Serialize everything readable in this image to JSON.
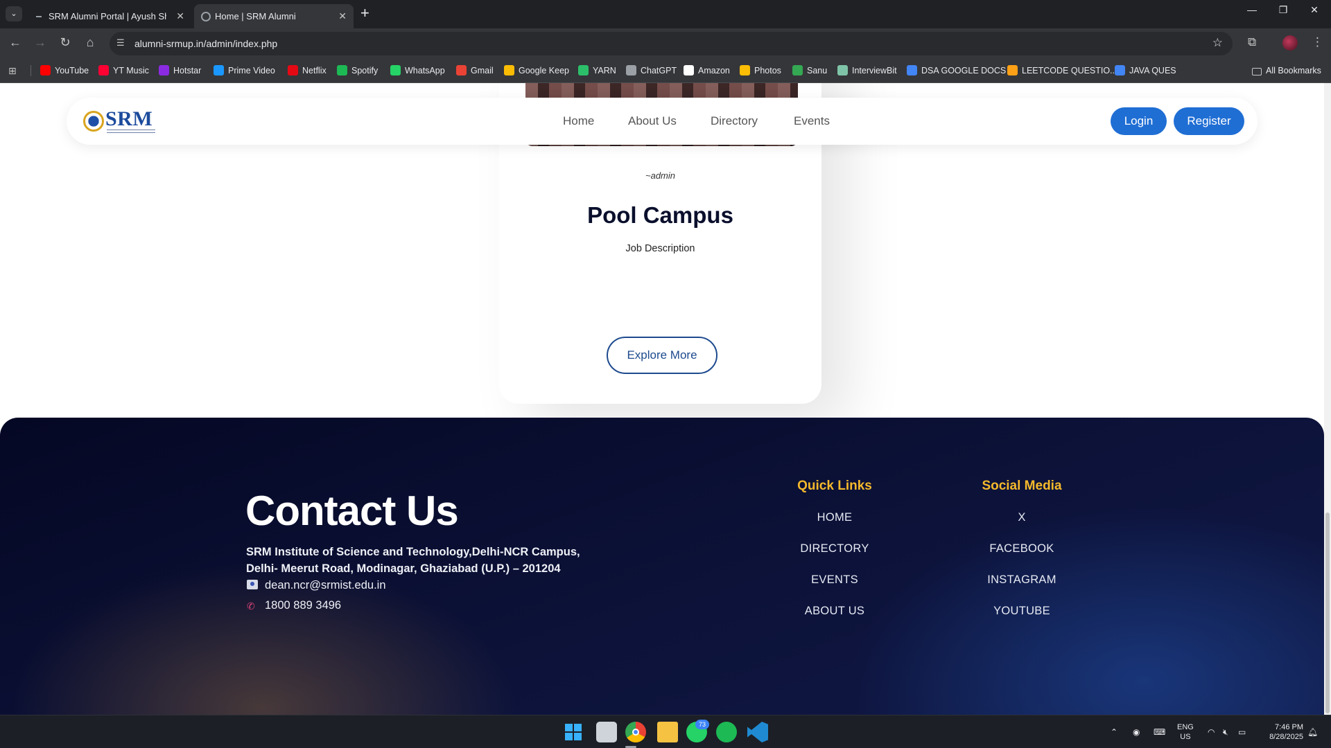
{
  "browser": {
    "tabs": [
      {
        "title": "SRM Alumni Portal | Ayush Sha",
        "active": false
      },
      {
        "title": "Home | SRM Alumni",
        "active": true
      }
    ],
    "url": "alumni-srmup.in/admin/index.php",
    "bookmarks": [
      {
        "label": "YouTube",
        "color": "#ff0000"
      },
      {
        "label": "YT Music",
        "color": "#ff0033"
      },
      {
        "label": "Hotstar",
        "color": "#8a2be2"
      },
      {
        "label": "Prime Video",
        "color": "#1a98ff"
      },
      {
        "label": "Netflix",
        "color": "#e50914"
      },
      {
        "label": "Spotify",
        "color": "#1db954"
      },
      {
        "label": "WhatsApp",
        "color": "#25d366"
      },
      {
        "label": "Gmail",
        "color": "#ea4335"
      },
      {
        "label": "Google Keep",
        "color": "#fbbc04"
      },
      {
        "label": "YARN",
        "color": "#2cbf6a"
      },
      {
        "label": "ChatGPT",
        "color": "#9aa0a6"
      },
      {
        "label": "Amazon",
        "color": "#ffffff"
      },
      {
        "label": "Photos",
        "color": "#fbbc04"
      },
      {
        "label": "Sanu",
        "color": "#34a853"
      },
      {
        "label": "InterviewBit",
        "color": "#7fc4a8"
      },
      {
        "label": "DSA GOOGLE DOCS",
        "color": "#4285f4"
      },
      {
        "label": "LEETCODE QUESTIO...",
        "color": "#ffa116"
      },
      {
        "label": "JAVA QUES",
        "color": "#4285f4"
      }
    ],
    "all_bookmarks": "All Bookmarks"
  },
  "header": {
    "logo_text": "SRM",
    "nav": [
      "Home",
      "About Us",
      "Directory",
      "Events"
    ],
    "login": "Login",
    "register": "Register"
  },
  "card": {
    "author": "~admin",
    "title": "Pool Campus",
    "description": "Job Description"
  },
  "explore_more": "Explore More",
  "footer": {
    "contact_title": "Contact Us",
    "address_line1": "SRM Institute of Science and Technology,Delhi-NCR Campus,",
    "address_line2": "Delhi- Meerut Road, Modinagar, Ghaziabad (U.P.) – 201204",
    "email": "dean.ncr@srmist.edu.in",
    "phone": "1800 889 3496",
    "quick_links_title": "Quick Links",
    "quick_links": [
      "HOME",
      "DIRECTORY",
      "EVENTS",
      "ABOUT US"
    ],
    "social_title": "Social Media",
    "social_links": [
      "X",
      "FACEBOOK",
      "INSTAGRAM",
      "YOUTUBE"
    ]
  },
  "taskbar": {
    "whatsapp_badge": "73",
    "lang_line1": "ENG",
    "lang_line2": "US",
    "time": "7:46 PM",
    "date": "8/28/2025"
  }
}
